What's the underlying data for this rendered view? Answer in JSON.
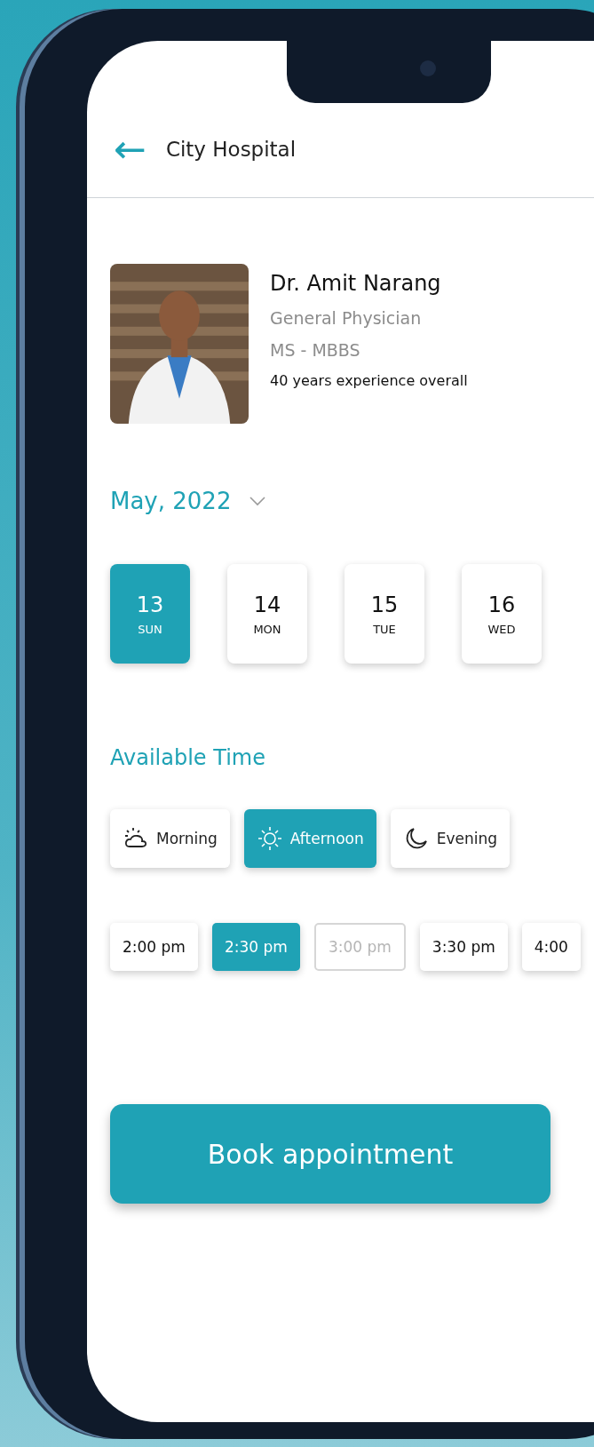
{
  "header": {
    "back": "←",
    "title": "City Hospital"
  },
  "doctor": {
    "name": "Dr. Amit Narang",
    "specialty": "General Physician",
    "degree": "MS - MBBS",
    "experience": "40 years experience overall"
  },
  "month": {
    "label": "May, 2022",
    "expanded": false
  },
  "dates": [
    {
      "day": "13",
      "weekday": "SUN",
      "selected": true
    },
    {
      "day": "14",
      "weekday": "MON",
      "selected": false
    },
    {
      "day": "15",
      "weekday": "TUE",
      "selected": false
    },
    {
      "day": "16",
      "weekday": "WED",
      "selected": false
    }
  ],
  "available_time": {
    "title": "Available Time",
    "periods": [
      {
        "kind": "morning",
        "label": "Morning",
        "selected": false
      },
      {
        "kind": "afternoon",
        "label": "Afternoon",
        "selected": true
      },
      {
        "kind": "evening",
        "label": "Evening",
        "selected": false
      }
    ],
    "slots": [
      {
        "label": "2:00 pm",
        "selected": false,
        "disabled": false
      },
      {
        "label": "2:30 pm",
        "selected": true,
        "disabled": false
      },
      {
        "label": "3:00 pm",
        "selected": false,
        "disabled": true
      },
      {
        "label": "3:30 pm",
        "selected": false,
        "disabled": false
      },
      {
        "label": "4:00",
        "selected": false,
        "disabled": false
      }
    ]
  },
  "book_button": "Book appointment"
}
